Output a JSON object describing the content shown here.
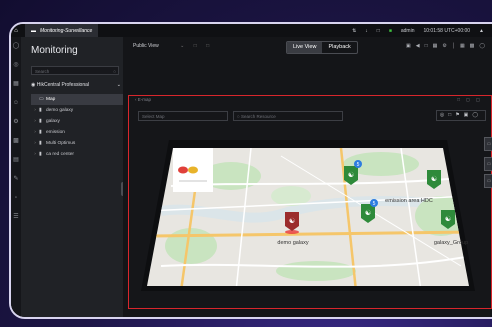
{
  "topbar": {
    "tab_label": "Monitoring-Surveillance",
    "user": "admin",
    "clock": "10:01:58 UTC+00:00"
  },
  "left_panel": {
    "title": "Monitoring",
    "search_placeholder": "Search",
    "site": "HikCentral Professional",
    "tree": [
      "Map",
      "demo galaxy",
      "galaxy",
      "emission",
      "Multi Optimus",
      "ca red center"
    ]
  },
  "toolbar": {
    "public_view": "Public View",
    "live_view": "Live View",
    "playback": "Playback"
  },
  "map_view": {
    "header": "E-map",
    "select_map_placeholder": "Select Map",
    "search_resource_placeholder": "Search Resource",
    "badges": [
      "5",
      "5"
    ],
    "labels": [
      "emission area HDC",
      "galaxy_Group",
      "demo galaxy"
    ]
  }
}
